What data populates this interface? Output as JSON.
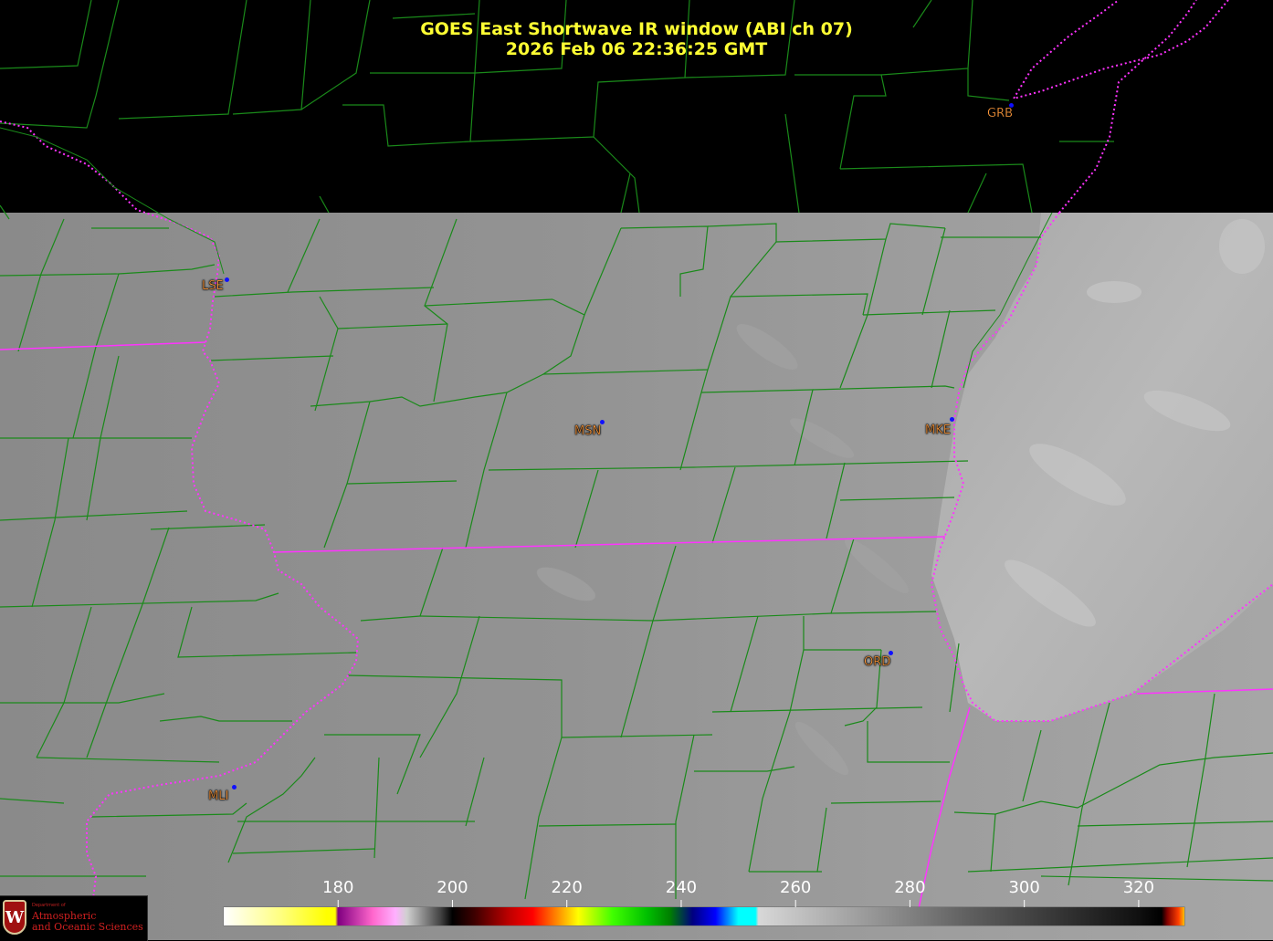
{
  "title": {
    "line1": "GOES East Shortwave IR window (ABI ch 07)",
    "line2": "2026 Feb 06  22:36:25 GMT"
  },
  "cities": [
    {
      "code": "GRB"
    },
    {
      "code": "LSE"
    },
    {
      "code": "MSN"
    },
    {
      "code": "MKE"
    },
    {
      "code": "ORD"
    },
    {
      "code": "MLI"
    }
  ],
  "colorbar": {
    "units_range": [
      160,
      328
    ],
    "ticks": [
      "180",
      "200",
      "220",
      "240",
      "260",
      "280",
      "300",
      "320"
    ]
  },
  "logo": {
    "line1": "Department of",
    "line2": "Atmospheric",
    "line3": "and Oceanic Sciences",
    "shield_letter": "W"
  },
  "colors": {
    "title": "#ffff33",
    "city_label": "#ff9a3c",
    "city_dot": "#1010ff",
    "county_lines": "#1a8a1a",
    "state_lines": "#ff33ff",
    "land": "#8e8e8e",
    "lake": "#b0b0b0",
    "missing": "#000000"
  },
  "layers": [
    "county-boundaries",
    "state-boundaries",
    "coastlines",
    "ir-imagery"
  ]
}
